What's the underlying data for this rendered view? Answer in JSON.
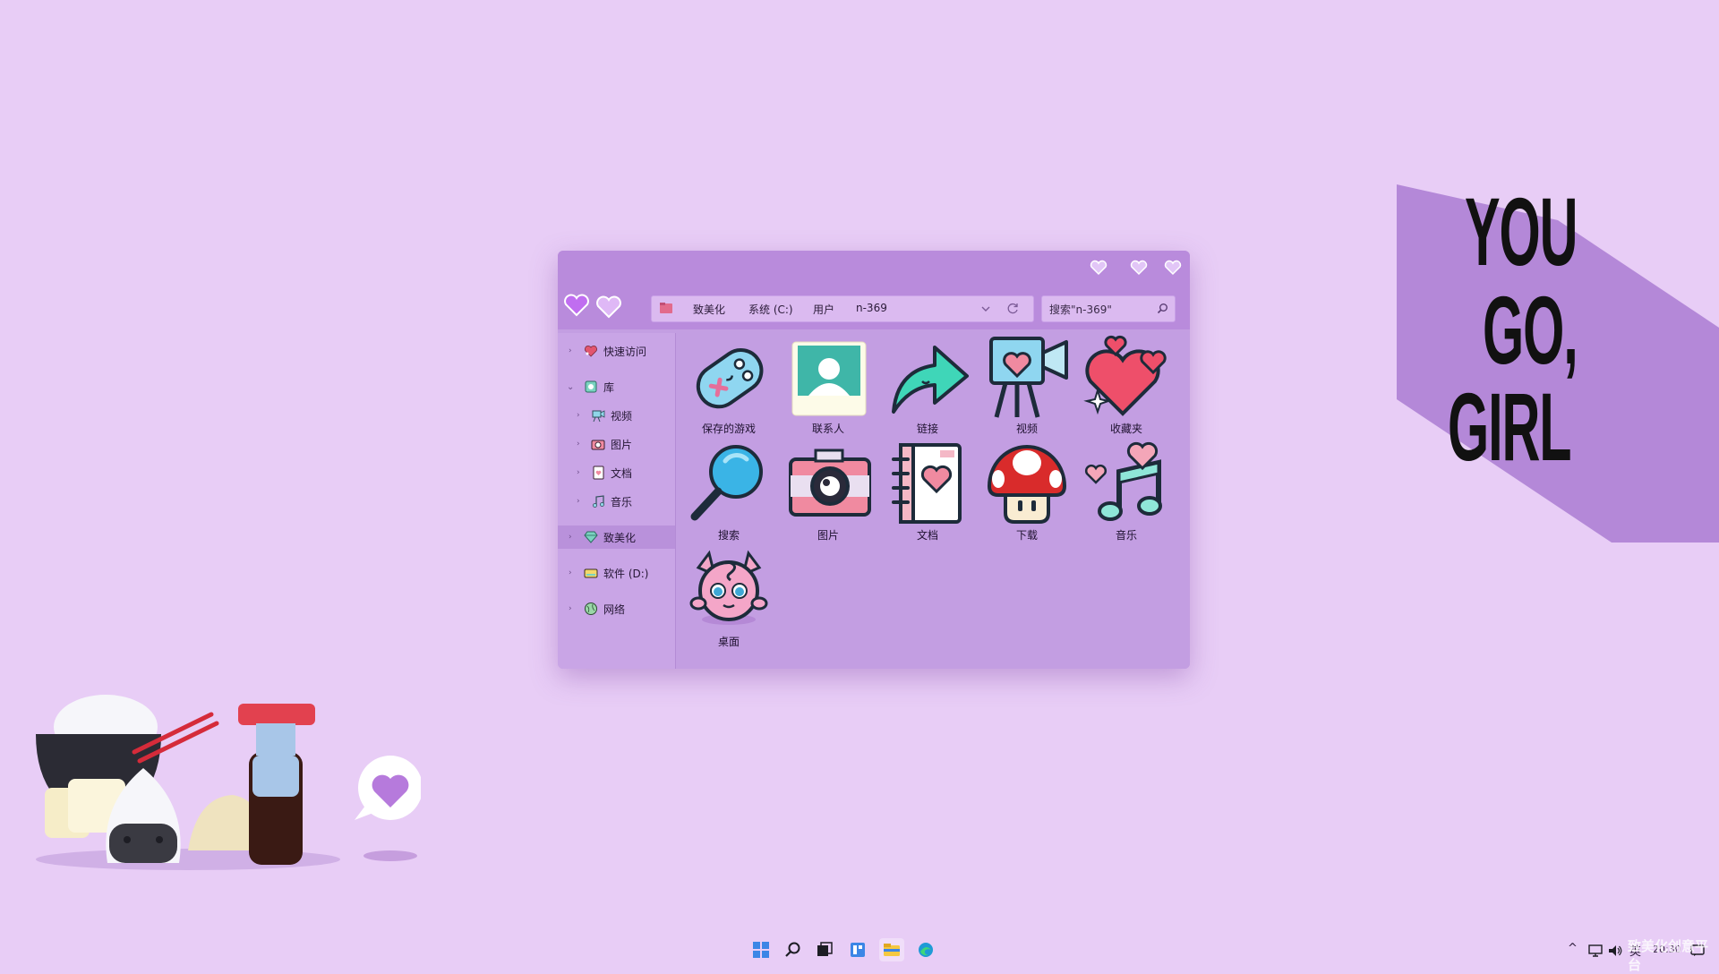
{
  "wallpaper": {
    "slogan": [
      "YOU",
      "GO,",
      "GIRL"
    ],
    "background_color": "#e8cdf6",
    "band_color": "#b488d8"
  },
  "window": {
    "controls": [
      "minimize-heart-icon",
      "maximize-heart-icon",
      "close-heart-icon"
    ],
    "nav_buttons": [
      "back-heart-icon",
      "forward-heart-icon"
    ],
    "address": {
      "folder_icon": "folder-icon",
      "crumbs": [
        "致美化",
        "系统 (C:)",
        "用户",
        "n-369"
      ],
      "dropdown_icon": "chevron-down-icon",
      "refresh_icon": "refresh-icon"
    },
    "search": {
      "placeholder": "搜索\"n-369\"",
      "icon": "search-icon"
    },
    "nav_pane": {
      "items": [
        {
          "label": "快速访问",
          "icon": "heart-star-icon",
          "expanded": false
        },
        {
          "label": "库",
          "icon": "library-icon",
          "expanded": true
        },
        {
          "label": "视频",
          "icon": "video-icon"
        },
        {
          "label": "图片",
          "icon": "camera-icon"
        },
        {
          "label": "文档",
          "icon": "document-icon"
        },
        {
          "label": "音乐",
          "icon": "music-icon"
        },
        {
          "label": "致美化",
          "icon": "diamond-icon",
          "selected": true
        },
        {
          "label": "软件 (D:)",
          "icon": "drive-icon"
        },
        {
          "label": "网络",
          "icon": "network-icon"
        }
      ]
    },
    "files": [
      {
        "label": "保存的游戏",
        "icon": "gamepad-icon"
      },
      {
        "label": "联系人",
        "icon": "contact-icon"
      },
      {
        "label": "链接",
        "icon": "link-arrow-icon"
      },
      {
        "label": "视频",
        "icon": "video-camera-icon"
      },
      {
        "label": "收藏夹",
        "icon": "favorites-heart-icon"
      },
      {
        "label": "搜索",
        "icon": "magnifier-icon"
      },
      {
        "label": "图片",
        "icon": "camera-icon"
      },
      {
        "label": "文档",
        "icon": "notebook-icon"
      },
      {
        "label": "下载",
        "icon": "mushroom-icon"
      },
      {
        "label": "音乐",
        "icon": "music-note-icon"
      },
      {
        "label": "桌面",
        "icon": "jigglypuff-icon"
      }
    ]
  },
  "taskbar": {
    "icons": [
      "start-icon",
      "search-icon",
      "task-view-icon",
      "widgets-icon",
      "file-explorer-icon",
      "edge-icon"
    ],
    "tray": {
      "chevron": "^",
      "ime": "英",
      "clock": "20:30"
    }
  },
  "watermark": "致美化创意平台"
}
